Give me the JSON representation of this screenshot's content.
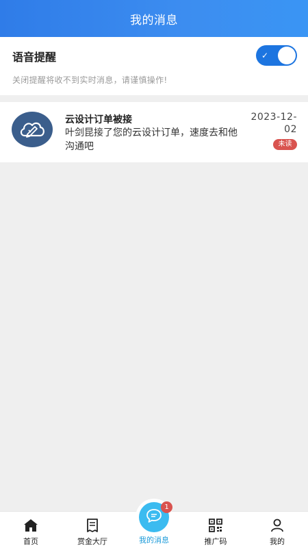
{
  "header": {
    "title": "我的消息"
  },
  "voice": {
    "title": "语音提醒",
    "hint": "关闭提醒将收不到实时消息，请谨慎操作!",
    "enabled": true
  },
  "messages": [
    {
      "title": "云设计订单被接",
      "body": "叶剑昆接了您的云设计订单，速度去和他沟通吧",
      "date": "2023-12-02",
      "status": "未读",
      "icon": "cloud-design-icon"
    }
  ],
  "tabbar": {
    "items": [
      {
        "label": "首页",
        "icon": "home-icon"
      },
      {
        "label": "赏金大厅",
        "icon": "bill-icon"
      },
      {
        "label": "我的消息",
        "icon": "chat-icon",
        "badge": "1",
        "active": true
      },
      {
        "label": "推广码",
        "icon": "qrcode-icon"
      },
      {
        "label": "我的",
        "icon": "user-icon"
      }
    ]
  },
  "colors": {
    "header": "#2f7ce8",
    "accent": "#1d75e0",
    "active_tab": "#1a9ad9",
    "badge": "#d9534f"
  }
}
